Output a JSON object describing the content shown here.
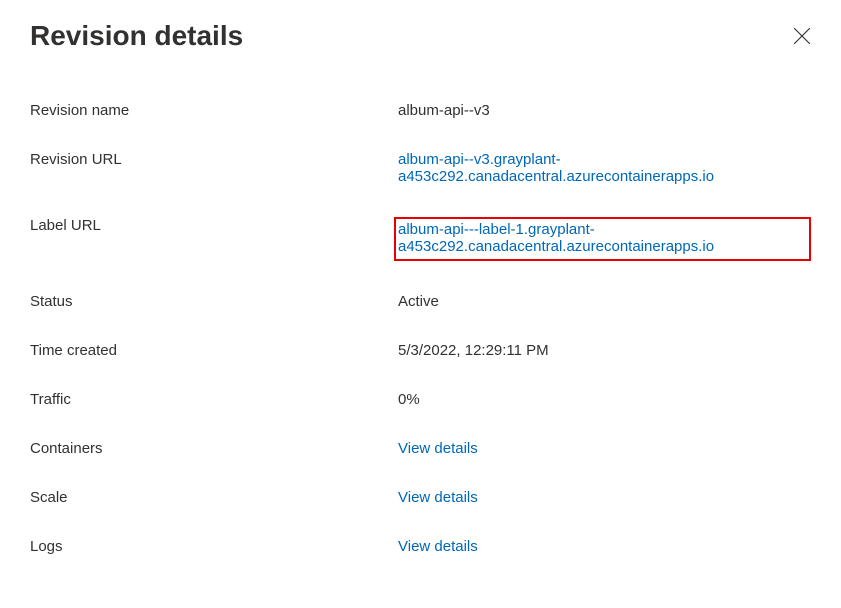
{
  "title": "Revision details",
  "fields": {
    "revision_name": {
      "label": "Revision name",
      "value": "album-api--v3"
    },
    "revision_url": {
      "label": "Revision URL",
      "value": "album-api--v3.grayplant-a453c292.canadacentral.azurecontainerapps.io"
    },
    "label_url": {
      "label": "Label URL",
      "value": "album-api---label-1.grayplant-a453c292.canadacentral.azurecontainerapps.io"
    },
    "status": {
      "label": "Status",
      "value": "Active"
    },
    "time_created": {
      "label": "Time created",
      "value": "5/3/2022, 12:29:11 PM"
    },
    "traffic": {
      "label": "Traffic",
      "value": "0%"
    },
    "containers": {
      "label": "Containers",
      "link_text": "View details"
    },
    "scale": {
      "label": "Scale",
      "link_text": "View details"
    },
    "logs": {
      "label": "Logs",
      "link_text": "View details"
    }
  }
}
